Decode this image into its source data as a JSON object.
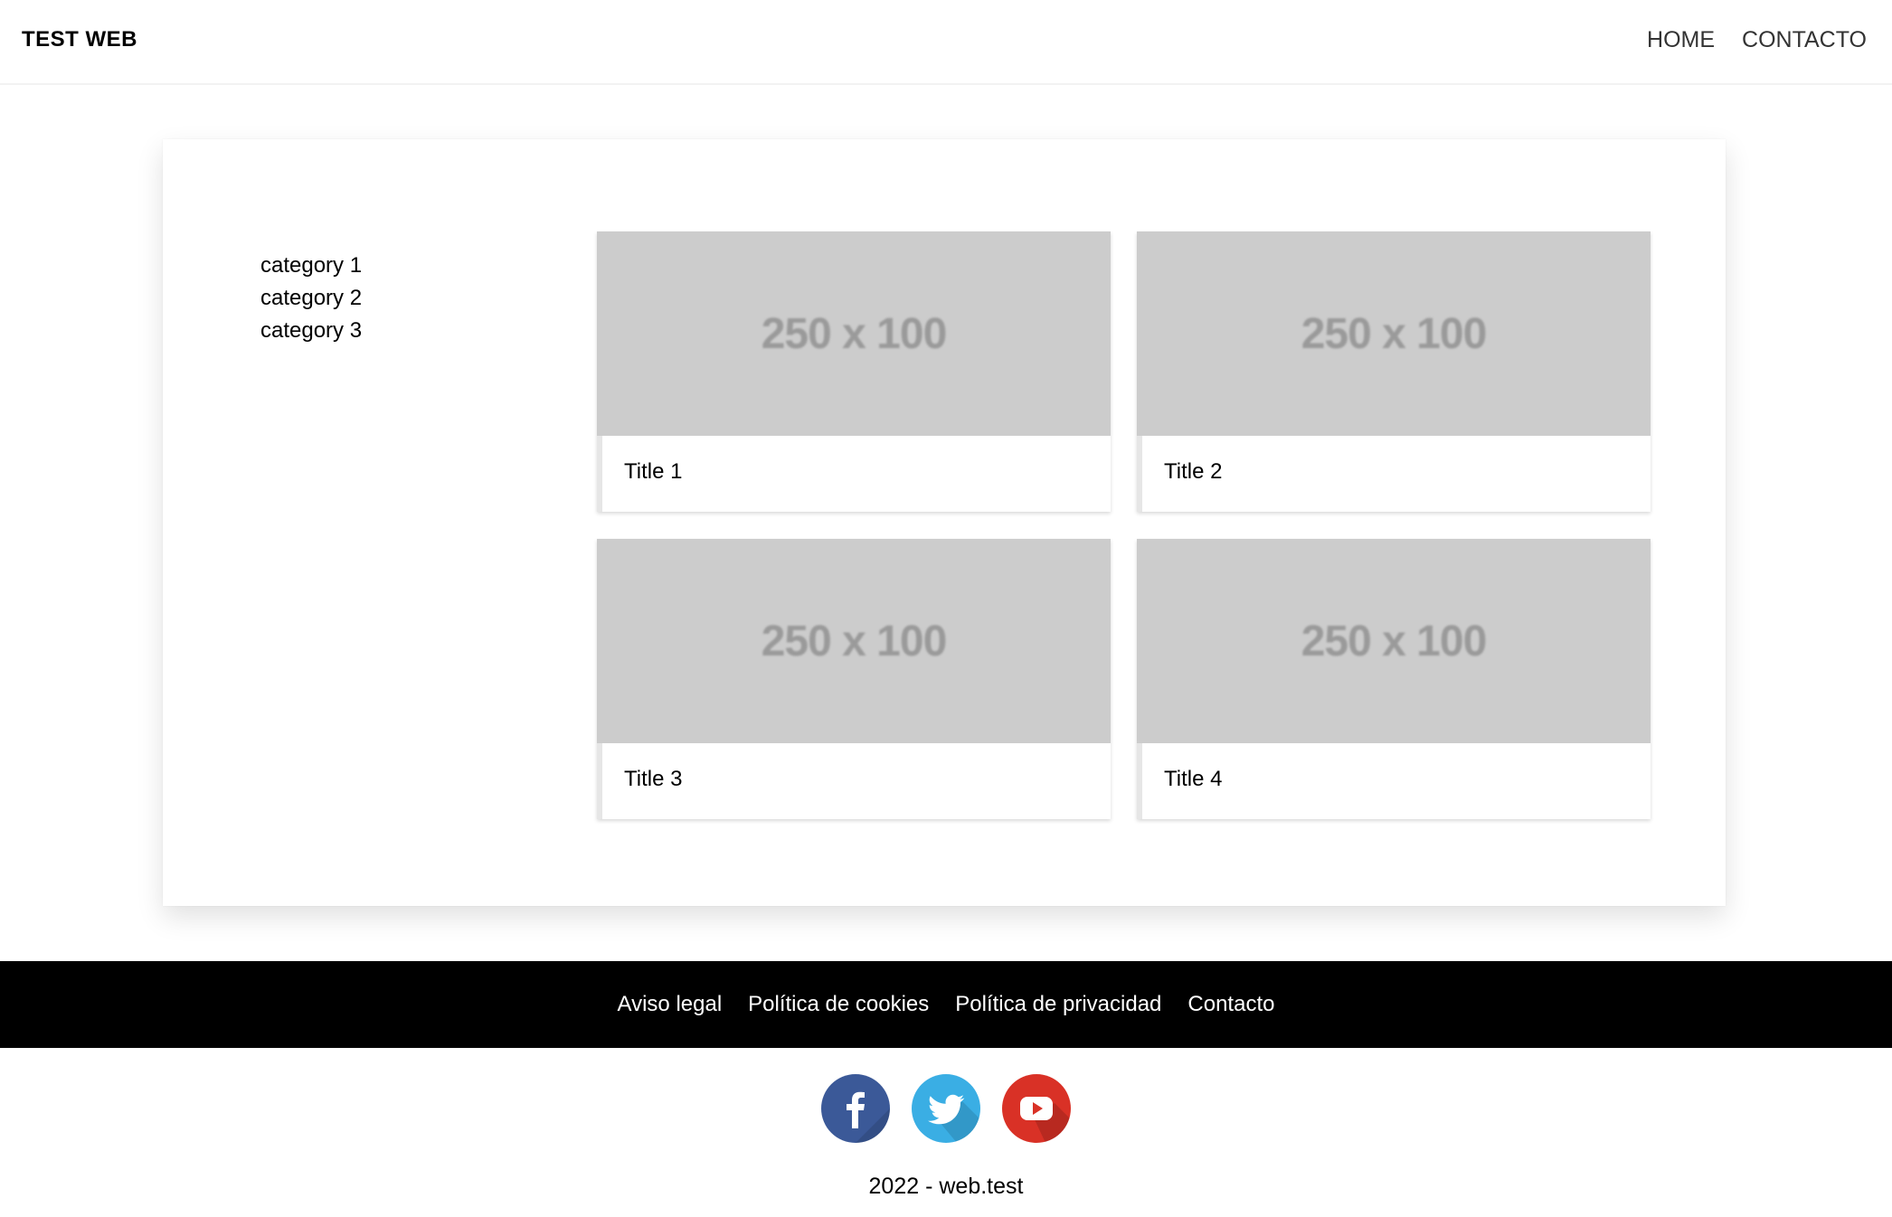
{
  "header": {
    "brand": "TEST WEB",
    "nav": [
      {
        "label": "HOME"
      },
      {
        "label": "CONTACTO"
      }
    ]
  },
  "sidebar": {
    "categories": [
      {
        "label": "category 1"
      },
      {
        "label": "category 2"
      },
      {
        "label": "category 3"
      }
    ]
  },
  "tiles": [
    {
      "placeholder": "250 x 100",
      "title": "Title 1"
    },
    {
      "placeholder": "250 x 100",
      "title": "Title 2"
    },
    {
      "placeholder": "250 x 100",
      "title": "Title 3"
    },
    {
      "placeholder": "250 x 100",
      "title": "Title 4"
    }
  ],
  "footer": {
    "links": [
      {
        "label": "Aviso legal"
      },
      {
        "label": "Política de cookies"
      },
      {
        "label": "Política de privacidad"
      },
      {
        "label": "Contacto"
      }
    ],
    "social": [
      {
        "icon": "facebook-icon",
        "color": "#3b5998"
      },
      {
        "icon": "twitter-icon",
        "color": "#3aaee4"
      },
      {
        "icon": "youtube-icon",
        "color": "#d93126"
      }
    ],
    "copyright": "2022 - web.test"
  }
}
